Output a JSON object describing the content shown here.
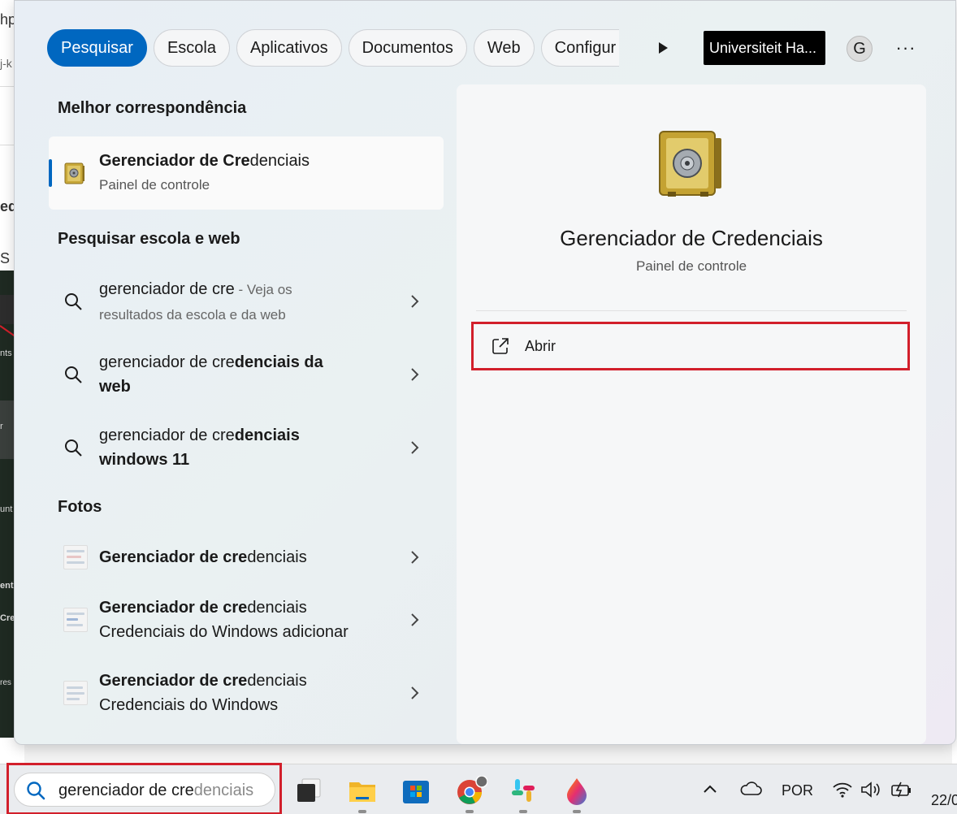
{
  "background": {
    "fragments": [
      "hp",
      "j-k",
      "ed",
      "S e",
      "nts",
      "r",
      "unt",
      "ent",
      "Cre",
      "res"
    ]
  },
  "filters": {
    "chips": [
      {
        "label": "Pesquisar",
        "active": true
      },
      {
        "label": "Escola"
      },
      {
        "label": "Aplicativos"
      },
      {
        "label": "Documentos"
      },
      {
        "label": "Web"
      },
      {
        "label": "Configur"
      }
    ],
    "organization": "Universiteit Ha...",
    "avatar_initial": "G",
    "more": "···"
  },
  "best_match": {
    "section_title": "Melhor correspondência",
    "title_bold": "Gerenciador de Cre",
    "title_rest": "denciais",
    "subtitle": "Painel de controle",
    "icon": "safe-icon"
  },
  "web_search": {
    "section_title": "Pesquisar escola e web",
    "items": [
      {
        "query": "gerenciador de cre",
        "suffix": " - Veja os",
        "suffix2": "resultados da escola e da web"
      },
      {
        "prefix": "gerenciador de cre",
        "bold": "denciais da",
        "line2": "web"
      },
      {
        "prefix": "gerenciador de cre",
        "bold": "denciais",
        "line2": "windows 11"
      }
    ]
  },
  "photos": {
    "section_title": "Fotos",
    "items": [
      {
        "bold": "Gerenciador de cre",
        "rest": "denciais",
        "line2": ""
      },
      {
        "bold": "Gerenciador de cre",
        "rest": "denciais",
        "line2": "Credenciais do Windows adicionar"
      },
      {
        "bold": "Gerenciador de cre",
        "rest": "denciais",
        "line2": "Credenciais do Windows"
      }
    ]
  },
  "preview": {
    "title": "Gerenciador de Credenciais",
    "subtitle": "Painel de controle",
    "open_label": "Abrir"
  },
  "taskbar": {
    "search_typed": "gerenciador de cre",
    "search_suggest": "denciais",
    "language": "POR",
    "clock": "22/0"
  }
}
